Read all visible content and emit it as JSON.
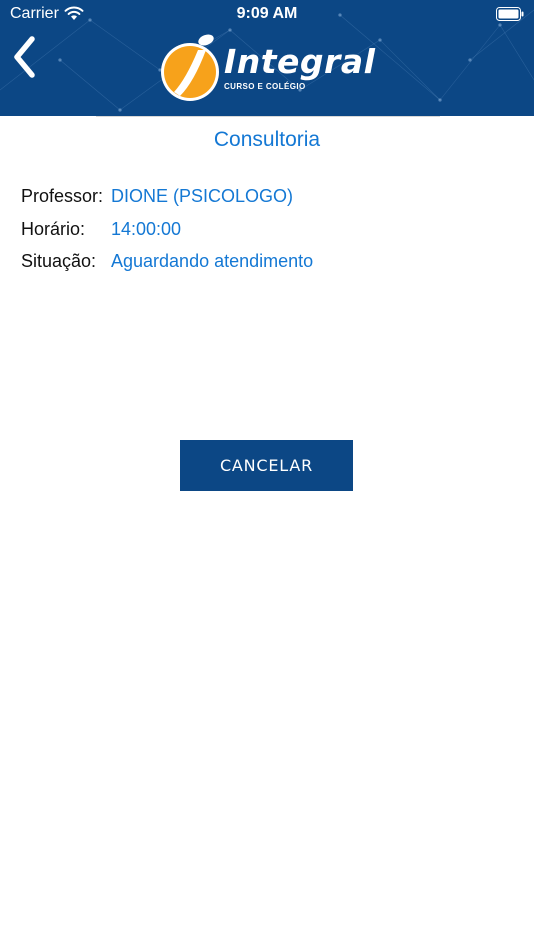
{
  "status_bar": {
    "carrier": "Carrier",
    "time": "9:09 AM"
  },
  "header": {
    "logo_name": "Integral",
    "logo_subtitle": "CURSO E COLÉGIO",
    "back_icon": "chevron-left-icon"
  },
  "page": {
    "title": "Consultoria"
  },
  "details": [
    {
      "label": "Professor:",
      "value": "DIONE (PSICOLOGO)"
    },
    {
      "label": "Horário:",
      "value": "14:00:00"
    },
    {
      "label": "Situação:",
      "value": "Aguardando atendimento"
    }
  ],
  "actions": {
    "cancel_label": "CANCELAR"
  },
  "colors": {
    "brand_blue": "#0c4785",
    "accent_blue": "#1478d4",
    "logo_orange": "#f7a21b"
  }
}
